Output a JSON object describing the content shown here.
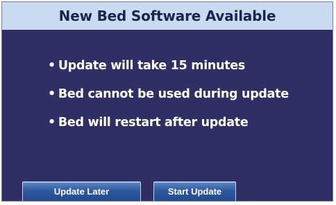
{
  "dialog": {
    "title": "New Bed Software Available",
    "bullet_symbol": "•",
    "bullets": [
      "Update will take 15 minutes",
      "Bed cannot be used during update",
      "Bed will restart after update"
    ]
  },
  "buttons": {
    "update_later": "Update Later",
    "start_update": "Start Update"
  },
  "colors": {
    "title_bar": "#c9dcef",
    "title_text": "#1c2452",
    "dialog_background": "#2f2f66",
    "button": "#2f5aa0"
  }
}
